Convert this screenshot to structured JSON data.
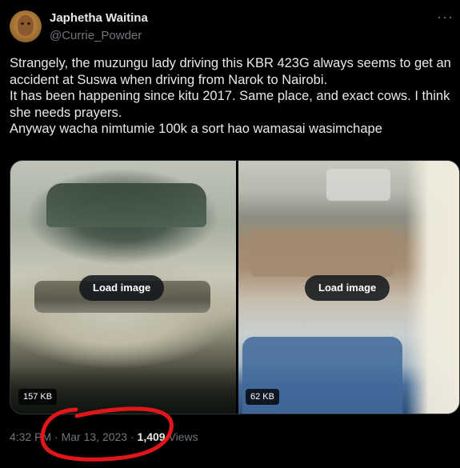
{
  "author": {
    "name": "Japhetha Waitina",
    "handle": "@Currie_Powder",
    "avatar_icon": "profile-avatar"
  },
  "more_icon": "ellipsis-icon",
  "more_label": "···",
  "tweet_text": [
    "Strangely, the muzungu lady driving this KBR 423G always seems to get an",
    "accident at Suswa when driving from Narok to Nairobi.",
    "It has been happening since kitu 2017. Same place, and exact cows. I think",
    "she needs prayers.",
    "Anyway wacha nimtumie 100k a sort hao wamasai wasimchape"
  ],
  "media": [
    {
      "button_label": "Load image",
      "size": "157 KB"
    },
    {
      "button_label": "Load image",
      "size": "62 KB"
    }
  ],
  "meta": {
    "time": "4:32 PM",
    "separator": "·",
    "date": "Mar 13, 2023",
    "views_count": "1,4",
    "views_obscured": "09",
    "views_label": "Views"
  },
  "colors": {
    "background": "#000000",
    "text_primary": "#e7e9ea",
    "text_secondary": "#71767b",
    "annotation_red": "#e0161b"
  }
}
